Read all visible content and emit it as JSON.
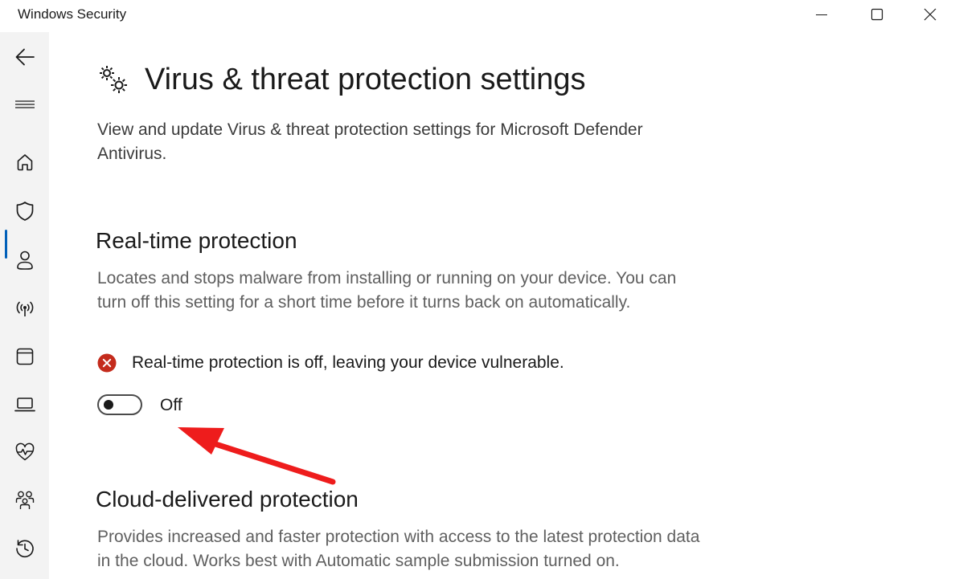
{
  "window": {
    "title": "Windows Security",
    "controls": {
      "minimize": "minimize-icon",
      "maximize": "maximize-icon",
      "close": "close-icon"
    }
  },
  "sidebar": {
    "items": [
      {
        "id": "back",
        "icon": "back-arrow-icon"
      },
      {
        "id": "menu",
        "icon": "hamburger-menu-icon"
      },
      {
        "id": "home",
        "icon": "home-icon"
      },
      {
        "id": "virus-threat-protection",
        "icon": "shield-icon",
        "selected": true
      },
      {
        "id": "account-protection",
        "icon": "person-icon"
      },
      {
        "id": "firewall-network",
        "icon": "wifi-broadcast-icon"
      },
      {
        "id": "app-browser-control",
        "icon": "app-window-icon"
      },
      {
        "id": "device-security",
        "icon": "laptop-icon"
      },
      {
        "id": "device-performance-health",
        "icon": "heart-pulse-icon"
      },
      {
        "id": "family-options",
        "icon": "family-icon"
      },
      {
        "id": "protection-history",
        "icon": "history-icon"
      }
    ],
    "accent_color": "#005fb8"
  },
  "page": {
    "icon": "gears-icon",
    "title": "Virus & threat protection settings",
    "description": "View and update Virus & threat protection settings for Microsoft Defender Antivirus."
  },
  "realtime": {
    "heading": "Real-time protection",
    "description": "Locates and stops malware from installing or running on your device. You can turn off this setting for a short time before it turns back on automatically.",
    "status_icon": "error-x-icon",
    "status_color": "#c42b1c",
    "status_text": "Real-time protection is off, leaving your device vulnerable.",
    "toggle_state": "Off"
  },
  "cloud": {
    "heading": "Cloud-delivered protection",
    "description": "Provides increased and faster protection with access to the latest protection data in the cloud. Works best with Automatic sample submission turned on."
  },
  "annotation": {
    "type": "red-arrow",
    "color": "#ee1c1c"
  }
}
